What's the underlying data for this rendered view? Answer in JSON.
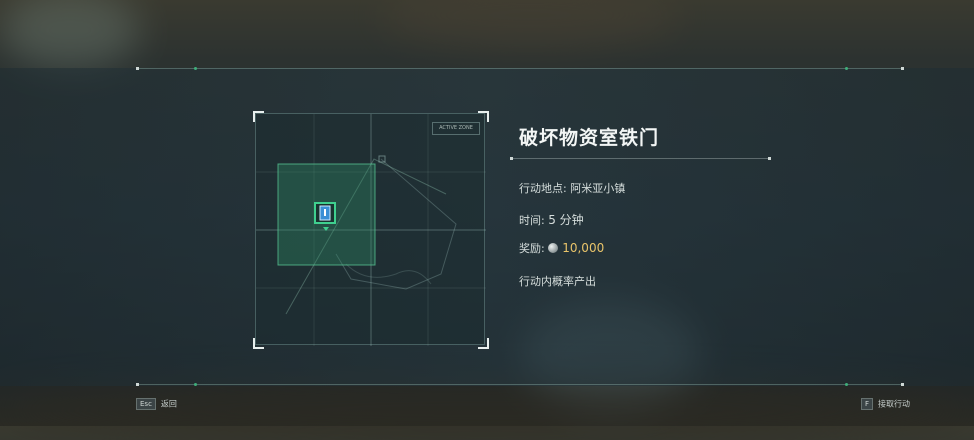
{
  "mission": {
    "title": "破坏物资室铁门",
    "location_label": "行动地点:",
    "location_value": "阿米亚小镇",
    "time_label": "时间:",
    "time_value": "5 分钟",
    "reward_label": "奖励:",
    "reward_value": "10,000",
    "note": "行动内概率产出"
  },
  "map": {
    "corner_tag": "ACTIVE ZONE",
    "marker_icon": "objective-door-icon"
  },
  "footer": {
    "back_key": "Esc",
    "back_label": "返回",
    "accept_key": "F",
    "accept_label": "接取行动"
  },
  "colors": {
    "accent_green": "#3fae7a",
    "reward_gold": "#e9c46a",
    "map_zone": "#2f8f68"
  }
}
